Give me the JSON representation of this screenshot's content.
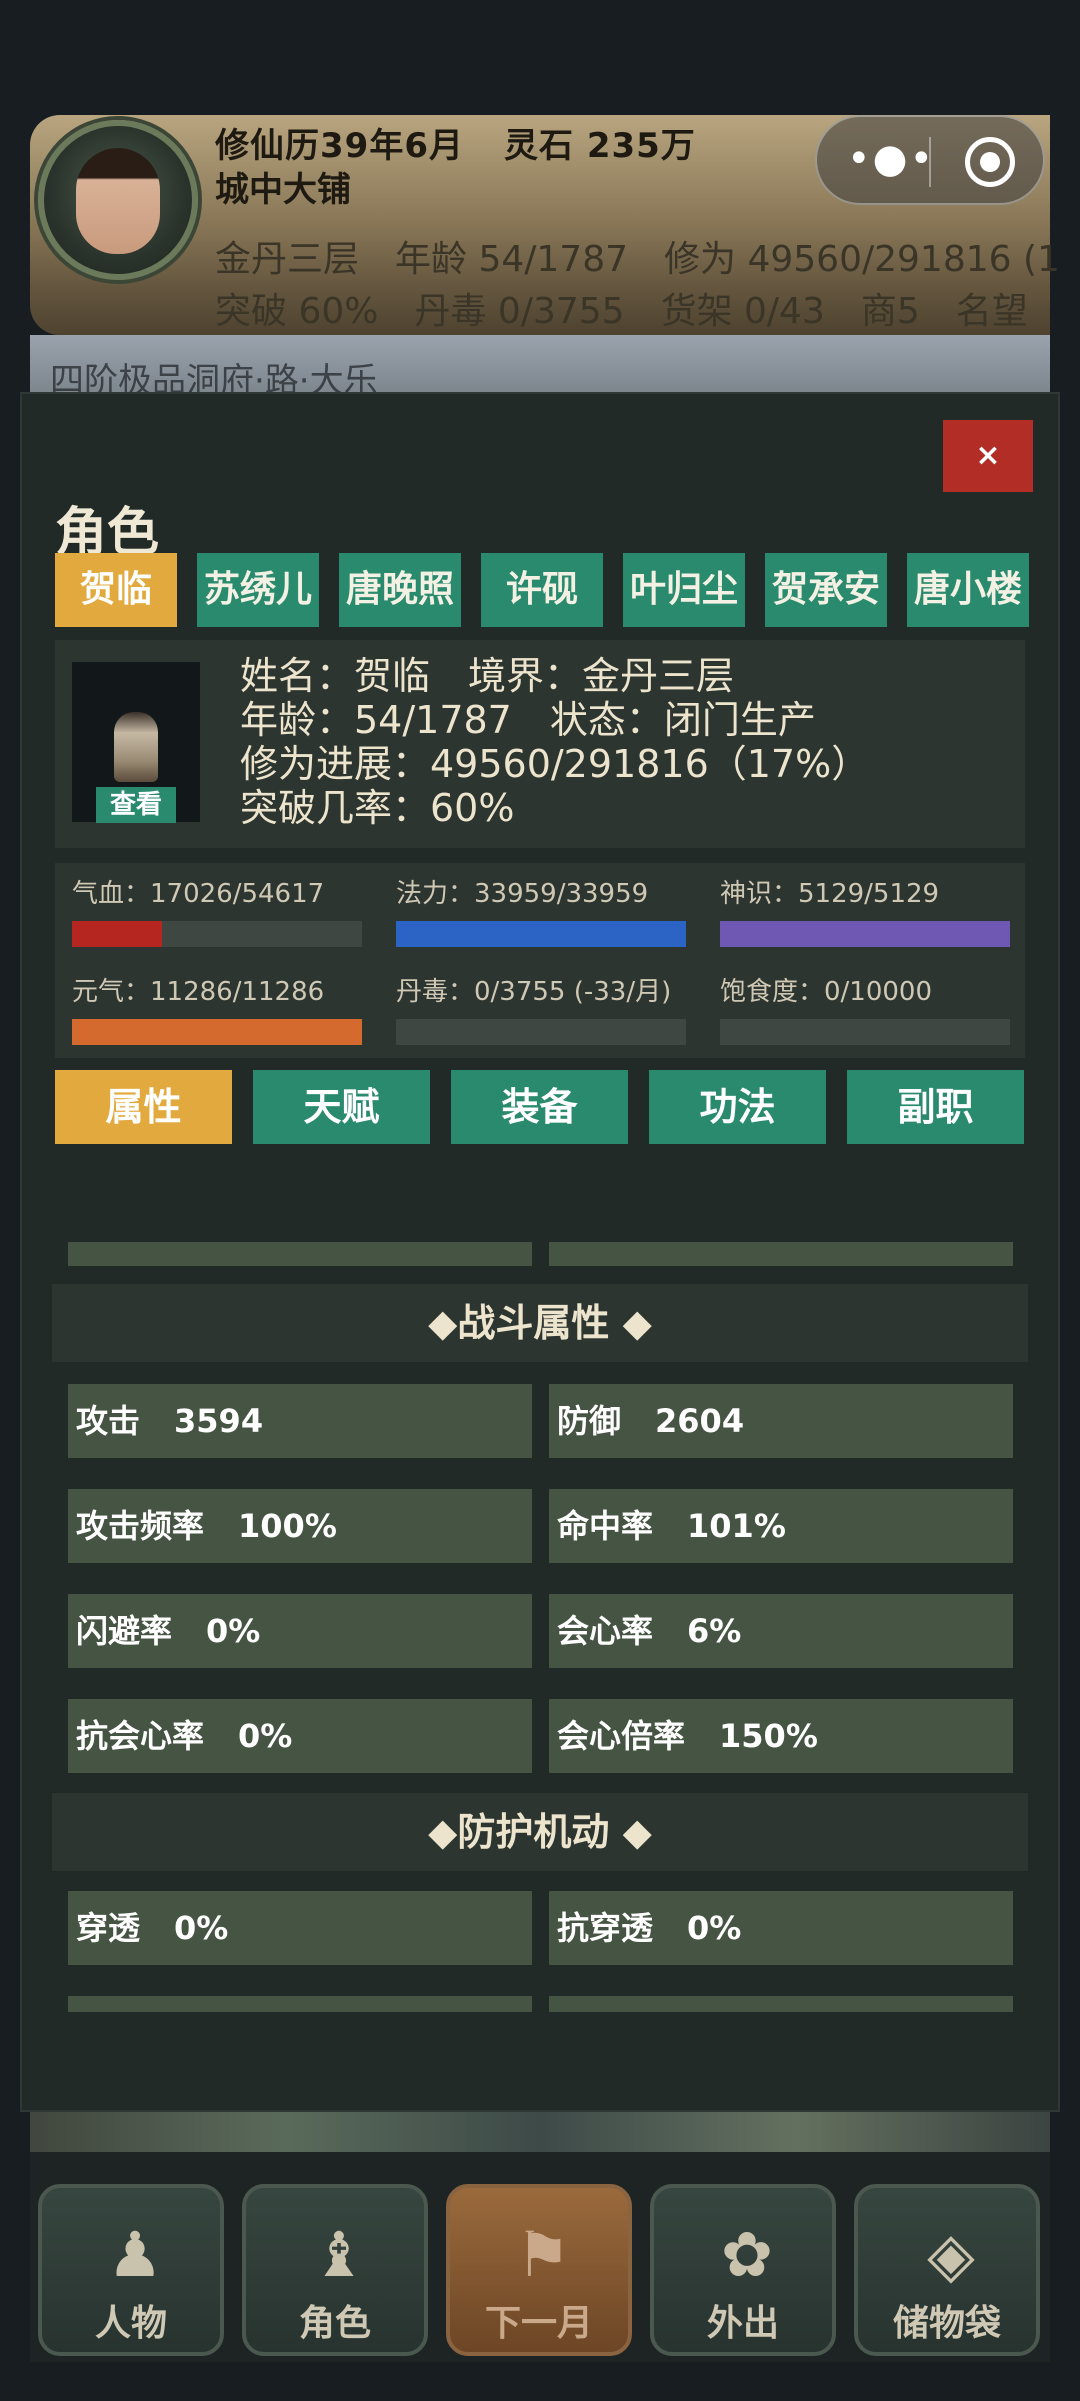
{
  "header": {
    "calendar": "修仙历39年6月",
    "spirit_stones": "灵石 235万",
    "location": "城中大铺",
    "stats_row1": [
      "金丹三层",
      "年龄 54/1787",
      "修为 49560/291816 (1"
    ],
    "stats_row2": [
      "突破 60%",
      "丹毒 0/3755",
      "货架 0/43",
      "商5",
      "名望"
    ],
    "background_text": "四阶极品洞府·路·大乐"
  },
  "capsule": {
    "more_icon": "more-dots-icon",
    "close_icon": "target-circle-icon"
  },
  "modal": {
    "close_label": "×",
    "title": "角色",
    "characters": [
      "贺临",
      "苏绣儿",
      "唐晚照",
      "许砚",
      "叶归尘",
      "贺承安",
      "唐小楼"
    ],
    "active_character": 0,
    "profile": {
      "view_label": "查看",
      "name_line": [
        "姓名：贺临",
        "境界：金丹三层"
      ],
      "age_line": [
        "年龄：54/1787",
        "状态：闭门生产"
      ],
      "progress": "修为进展：49560/291816（17%）",
      "breakthrough": "突破几率：60%"
    },
    "vitals": [
      {
        "label": "气血：17026/54617",
        "fraction": 0.31,
        "color": "#b52620"
      },
      {
        "label": "法力：33959/33959",
        "fraction": 1.0,
        "color": "#2b64c4"
      },
      {
        "label": "神识：5129/5129",
        "fraction": 1.0,
        "color": "#6e58b4"
      },
      {
        "label": "元气：11286/11286",
        "fraction": 1.0,
        "color": "#d46a2e"
      },
      {
        "label": "丹毒：0/3755 (-33/月)",
        "fraction": 0,
        "color": "#5a6a5a"
      },
      {
        "label": "饱食度：0/10000",
        "fraction": 0,
        "color": "#5a6a5a"
      }
    ],
    "section_tabs": [
      "属性",
      "天赋",
      "装备",
      "功法",
      "副职"
    ],
    "active_section": 0,
    "combat_header": "◆战斗属性 ◆",
    "combat": [
      {
        "label": "攻击",
        "value": "3594"
      },
      {
        "label": "防御",
        "value": "2604"
      },
      {
        "label": "攻击频率",
        "value": "100%"
      },
      {
        "label": "命中率",
        "value": "101%"
      },
      {
        "label": "闪避率",
        "value": "0%"
      },
      {
        "label": "会心率",
        "value": "6%"
      },
      {
        "label": "抗会心率",
        "value": "0%"
      },
      {
        "label": "会心倍率",
        "value": "150%"
      }
    ],
    "defense_header": "◆防护机动 ◆",
    "defense": [
      {
        "label": "穿透",
        "value": "0%"
      },
      {
        "label": "抗穿透",
        "value": "0%"
      }
    ]
  },
  "nav": [
    {
      "label": "人物",
      "icon": "person-icon"
    },
    {
      "label": "角色",
      "icon": "robed-figure-icon"
    },
    {
      "label": "下一月",
      "icon": "flag-icon"
    },
    {
      "label": "外出",
      "icon": "lotus-figure-icon"
    },
    {
      "label": "储物袋",
      "icon": "pouch-icon"
    }
  ]
}
